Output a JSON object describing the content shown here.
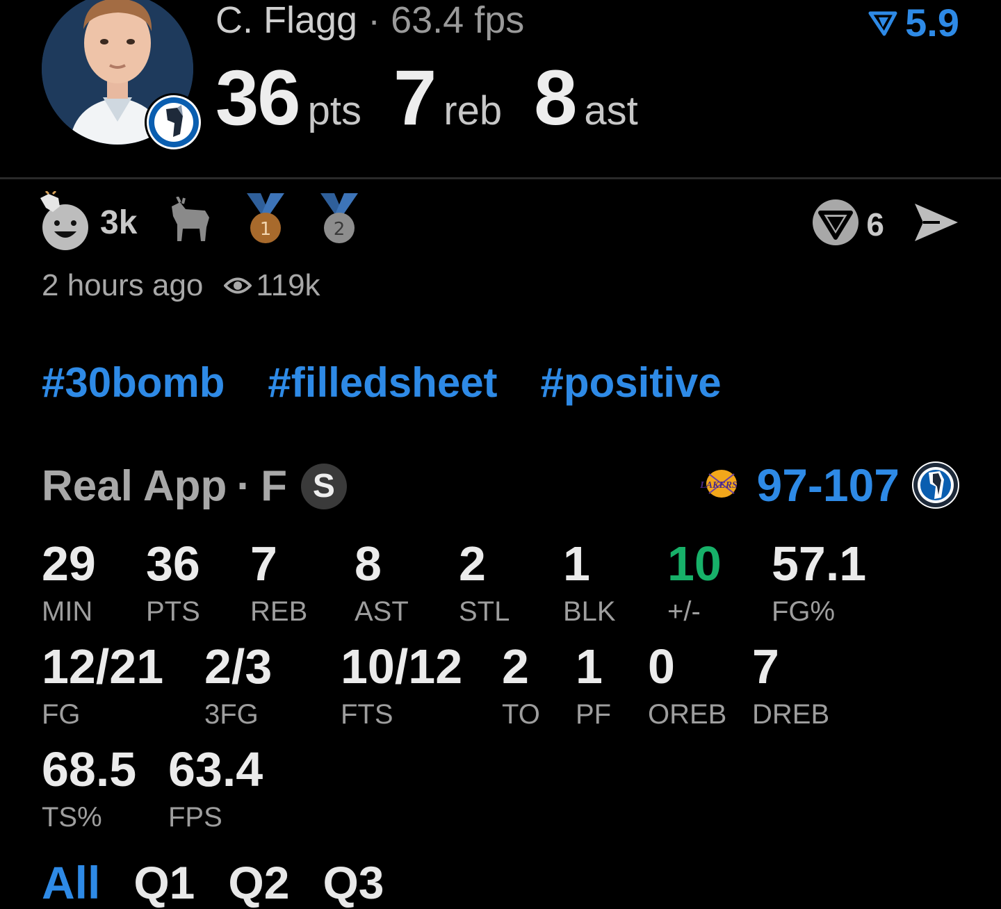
{
  "header": {
    "player_name": "C. Flagg",
    "separator": "·",
    "fps_text": "63.4 fps",
    "vote_score": "5.9",
    "line": [
      {
        "value": "36",
        "unit": "pts"
      },
      {
        "value": "7",
        "unit": "reb"
      },
      {
        "value": "8",
        "unit": "ast"
      }
    ]
  },
  "reactions": {
    "count": "3k",
    "icons": [
      "smile-goat-icon",
      "goat-icon",
      "bronze-medal-icon",
      "silver-medal-icon"
    ],
    "medal_1": "1",
    "medal_2": "2"
  },
  "actions": {
    "comment_count": "6"
  },
  "meta": {
    "time_ago": "2 hours ago",
    "views": "119k"
  },
  "tags": [
    "#30bomb",
    "#filledsheet",
    "#positive"
  ],
  "game": {
    "source": "Real App",
    "separator": "·",
    "position": "F",
    "badge": "S",
    "score": "97-107",
    "away_logo_text": "LAKERS"
  },
  "stats": {
    "row1": [
      {
        "value": "29",
        "label": "MIN"
      },
      {
        "value": "36",
        "label": "PTS"
      },
      {
        "value": "7",
        "label": "REB"
      },
      {
        "value": "8",
        "label": "AST"
      },
      {
        "value": "2",
        "label": "STL"
      },
      {
        "value": "1",
        "label": "BLK"
      },
      {
        "value": "10",
        "label": "+/-"
      },
      {
        "value": "57.1",
        "label": "FG%"
      }
    ],
    "row2": [
      {
        "value": "12/21",
        "label": "FG"
      },
      {
        "value": "2/3",
        "label": "3FG"
      },
      {
        "value": "10/12",
        "label": "FTS"
      },
      {
        "value": "2",
        "label": "TO"
      },
      {
        "value": "1",
        "label": "PF"
      },
      {
        "value": "0",
        "label": "OREB"
      },
      {
        "value": "7",
        "label": "DREB"
      }
    ],
    "row3": [
      {
        "value": "68.5",
        "label": "TS%"
      },
      {
        "value": "63.4",
        "label": "FPS"
      }
    ]
  },
  "tabs": [
    "All",
    "Q1",
    "Q2",
    "Q3"
  ],
  "colors": {
    "accent_blue": "#2e8ae6",
    "positive_green": "#17b169",
    "background": "#000000"
  }
}
